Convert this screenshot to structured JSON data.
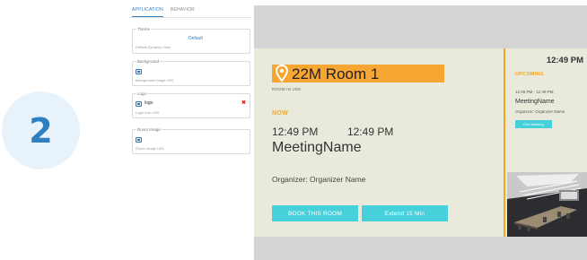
{
  "step": {
    "number": "2"
  },
  "settings": {
    "tabs": [
      {
        "label": "APPLICATION",
        "active": true
      },
      {
        "label": "BEHAVIOR",
        "active": false
      }
    ],
    "theme": {
      "legend": "Theme",
      "value": "Default",
      "helper": "Default Symplus Visio"
    },
    "background": {
      "legend": "Background",
      "helper": "Background Image URL"
    },
    "logo": {
      "legend": "Logo",
      "value": "logo",
      "helper": "Logo Icon URL",
      "remove_icon": "close-icon"
    },
    "room_image": {
      "legend": "Room Image",
      "helper": "Room Image URL"
    }
  },
  "preview": {
    "room_name": "22M Room 1",
    "room_status": "ROOM IN USE",
    "now_label": "NOW",
    "current_meeting": {
      "start": "12:49 PM",
      "end": "12:49 PM",
      "name": "MeetingName",
      "organizer": "Organizer: Organizer Name"
    },
    "buttons": {
      "book": "BOOK THIS ROOM",
      "extend": "Extend 15 Min"
    },
    "sidebar": {
      "clock": "12:49 PM",
      "upcoming_label": "UPCOMING",
      "times": "12:49 PM   - 12:49 PM",
      "meeting": "MeetingName",
      "organizer": "Organizer: Organizer Name",
      "end_button": "End Meeting"
    },
    "colors": {
      "accent": "#f5a623",
      "button": "#46d0d9",
      "screen_bg": "#eaeadc",
      "frame_bg": "#d4d4d4"
    }
  }
}
